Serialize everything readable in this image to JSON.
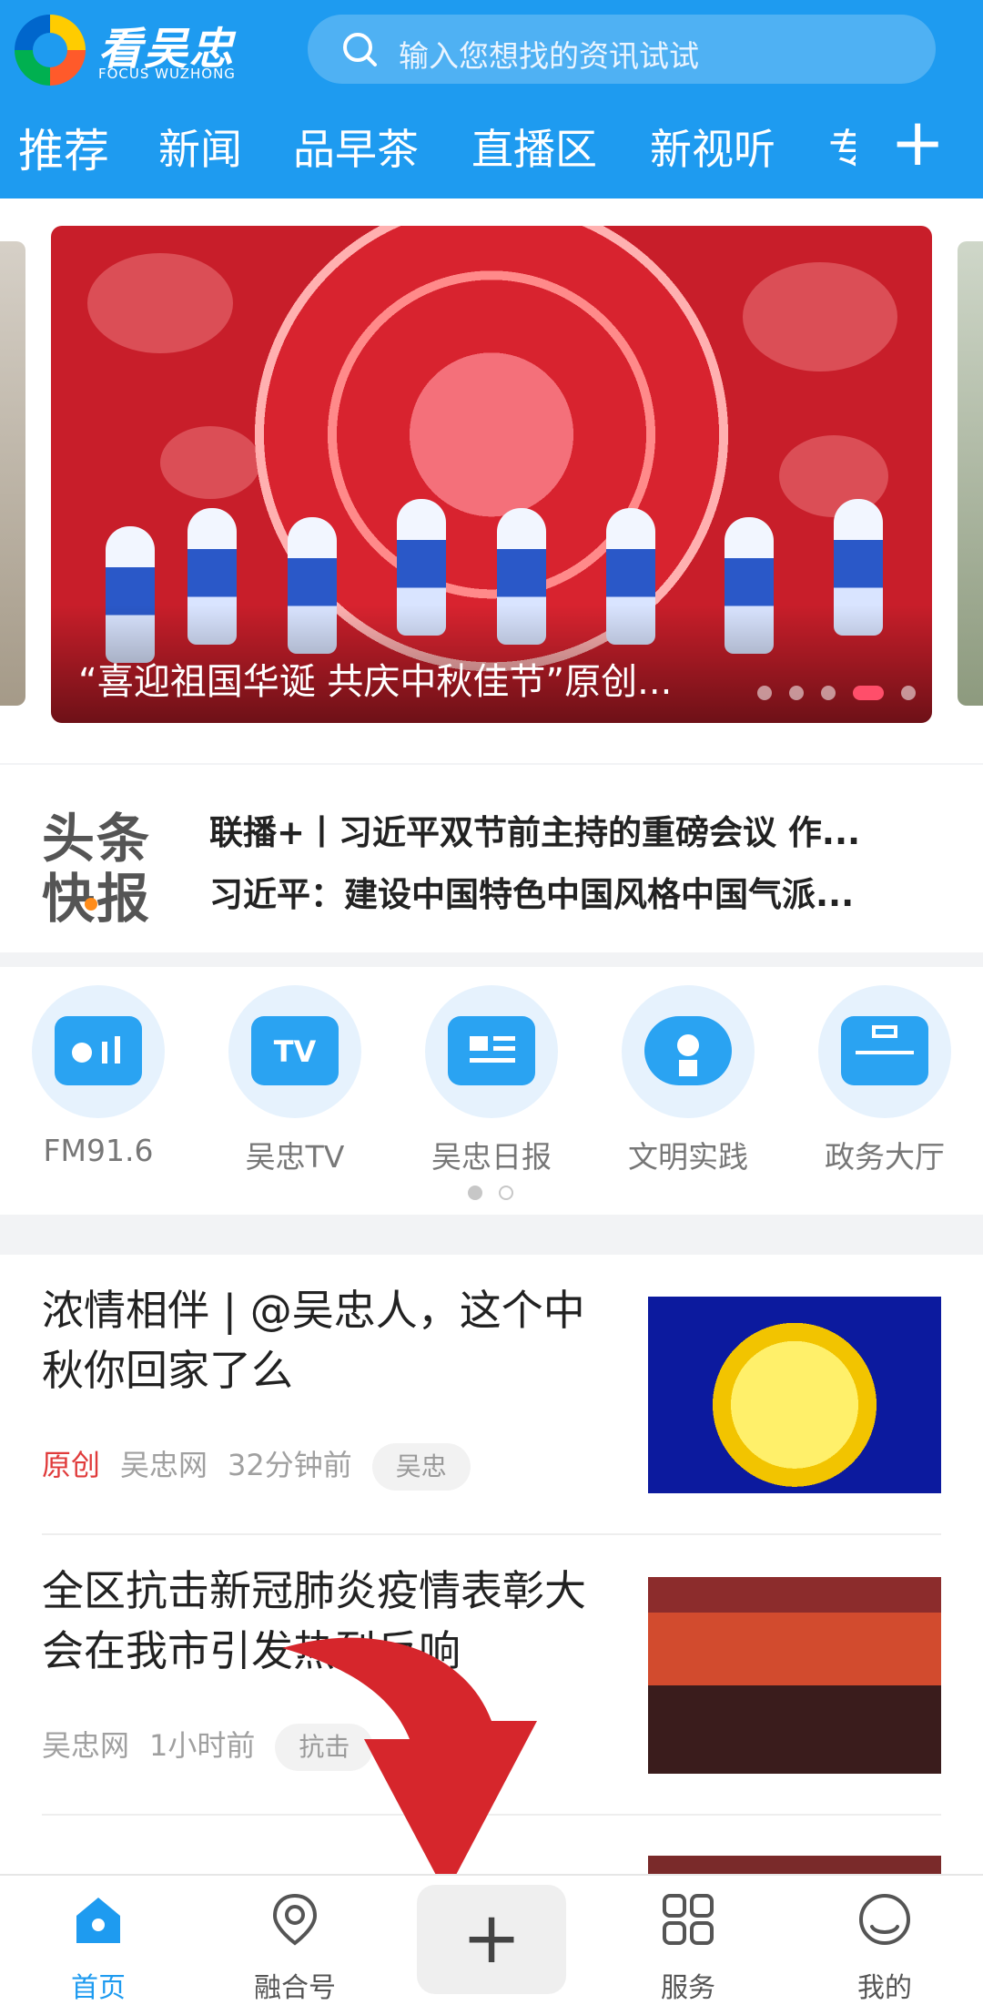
{
  "header": {
    "logo_title": "看吴忠",
    "logo_subtitle": "FOCUS WUZHONG",
    "search_placeholder": "输入您想找的资讯试试",
    "tabs": [
      {
        "label": "推荐"
      },
      {
        "label": "新闻"
      },
      {
        "label": "品早茶"
      },
      {
        "label": "直播区"
      },
      {
        "label": "新视听"
      }
    ],
    "tab_partial": "专",
    "add_label": "+"
  },
  "banner": {
    "caption": "“喜迎祖国华诞 共庆中秋佳节”原创...",
    "dots_count": 5,
    "active_dot": 4
  },
  "headline": {
    "logo_line1": "头条",
    "logo_line2": "快报",
    "items": [
      {
        "text": "联播+丨习近平双节前主持的重磅会议 作..."
      },
      {
        "text": "习近平：建设中国特色中国风格中国气派..."
      }
    ]
  },
  "services": {
    "items": [
      {
        "label": "FM91.6",
        "icon": "radio-icon"
      },
      {
        "label": "吴忠TV",
        "icon": "tv-icon"
      },
      {
        "label": "吴忠日报",
        "icon": "newspaper-icon"
      },
      {
        "label": "文明实践",
        "icon": "badge-icon"
      },
      {
        "label": "政务大厅",
        "icon": "briefcase-icon"
      }
    ],
    "page": 1,
    "pages": 2
  },
  "news": {
    "items": [
      {
        "title": "浓情相伴 | @吴忠人，这个中秋你回家了么",
        "original": "原创",
        "source": "吴忠网",
        "time": "32分钟前",
        "tag": "吴忠"
      },
      {
        "title": "全区抗击新冠肺炎疫情表彰大会在我市引发热烈反响",
        "original": "",
        "source": "吴忠网",
        "time": "1小时前",
        "tag": "抗击"
      }
    ]
  },
  "bottom_nav": {
    "items": [
      {
        "label": "首页",
        "icon": "home-icon",
        "active": true
      },
      {
        "label": "融合号",
        "icon": "location-pin-icon"
      },
      {
        "label": "服务",
        "icon": "grid-icon"
      },
      {
        "label": "我的",
        "icon": "profile-icon"
      }
    ],
    "publish_label": "+"
  },
  "colors": {
    "brand_blue": "#1e9bf0",
    "original_red": "#e03b3b",
    "arrow_red": "#d6262c"
  }
}
